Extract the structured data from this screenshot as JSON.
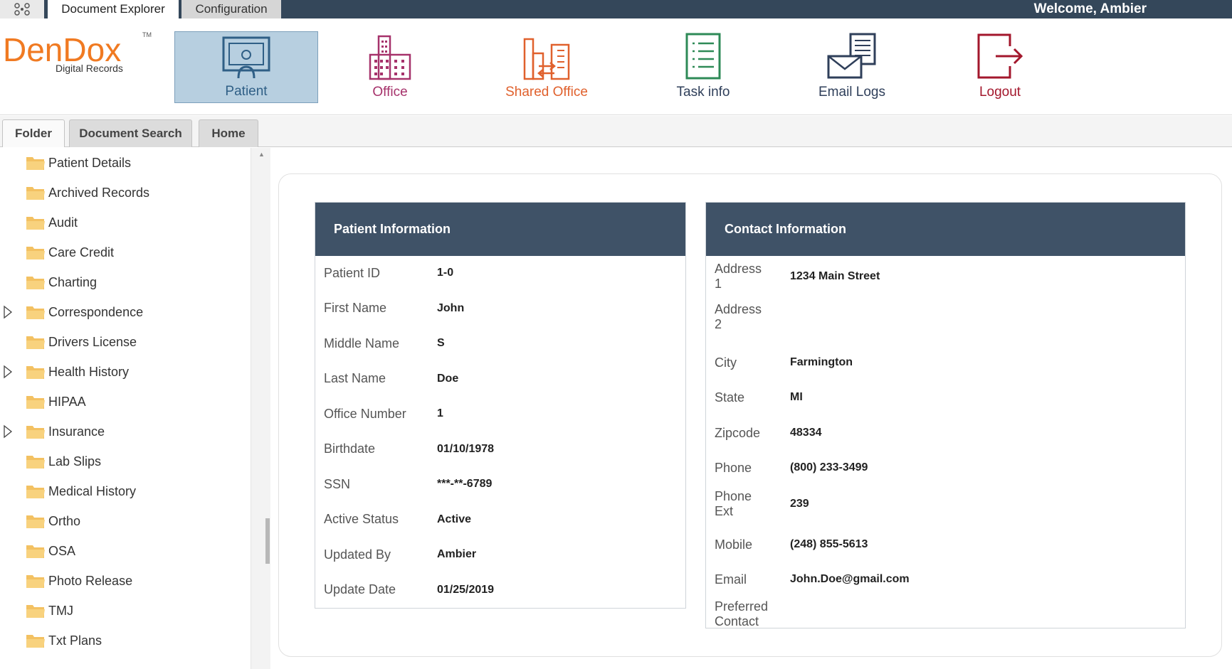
{
  "topbar": {
    "grid_icon": "apps-grid-icon",
    "tabs": [
      "Document Explorer",
      "Configuration"
    ],
    "welcome": "Welcome, Ambier"
  },
  "logo": {
    "main": "DenDox",
    "tm": "TM",
    "sub": "Digital Records"
  },
  "nav": [
    {
      "label": "Patient",
      "icon": "patient-id-card-icon",
      "color": "#2f5f86"
    },
    {
      "label": "Office",
      "icon": "office-building-icon",
      "color": "#a6326b"
    },
    {
      "label": "Shared Office",
      "icon": "shared-office-icon",
      "color": "#e0612d"
    },
    {
      "label": "Task info",
      "icon": "task-list-icon",
      "color": "#2e8a57"
    },
    {
      "label": "Email Logs",
      "icon": "email-log-icon",
      "color": "#2f3f5a"
    },
    {
      "label": "Logout",
      "icon": "logout-icon",
      "color": "#a3172c"
    }
  ],
  "tabs": [
    "Folder",
    "Document Search",
    "Home"
  ],
  "folders": [
    {
      "label": "Patient Details",
      "expandable": false
    },
    {
      "label": "Archived Records",
      "expandable": false
    },
    {
      "label": "Audit",
      "expandable": false
    },
    {
      "label": "Care Credit",
      "expandable": false
    },
    {
      "label": "Charting",
      "expandable": false
    },
    {
      "label": "Correspondence",
      "expandable": true
    },
    {
      "label": "Drivers License",
      "expandable": false
    },
    {
      "label": "Health History",
      "expandable": true
    },
    {
      "label": "HIPAA",
      "expandable": false
    },
    {
      "label": "Insurance",
      "expandable": true
    },
    {
      "label": "Lab Slips",
      "expandable": false
    },
    {
      "label": "Medical History",
      "expandable": false
    },
    {
      "label": "Ortho",
      "expandable": false
    },
    {
      "label": "OSA",
      "expandable": false
    },
    {
      "label": "Photo Release",
      "expandable": false
    },
    {
      "label": "TMJ",
      "expandable": false
    },
    {
      "label": "Txt Plans",
      "expandable": false
    }
  ],
  "patient_info": {
    "title": "Patient Information",
    "rows": [
      {
        "label": "Patient ID",
        "value": "1-0"
      },
      {
        "label": "First Name",
        "value": "John"
      },
      {
        "label": "Middle Name",
        "value": "S"
      },
      {
        "label": "Last Name",
        "value": "Doe"
      },
      {
        "label": "Office Number",
        "value": "1"
      },
      {
        "label": "Birthdate",
        "value": "01/10/1978"
      },
      {
        "label": "SSN",
        "value": "***-**-6789"
      },
      {
        "label": "Active Status",
        "value": "Active"
      },
      {
        "label": "Updated By",
        "value": "Ambier"
      },
      {
        "label": "Update Date",
        "value": "01/25/2019"
      }
    ]
  },
  "contact_info": {
    "title": "Contact Information",
    "rows": [
      {
        "label": "Address 1",
        "value": "1234 Main Street"
      },
      {
        "label": "Address 2",
        "value": ""
      },
      {
        "label": "City",
        "value": "Farmington"
      },
      {
        "label": "State",
        "value": "MI"
      },
      {
        "label": "Zipcode",
        "value": "48334"
      },
      {
        "label": "Phone",
        "value": "(800) 233-3499"
      },
      {
        "label": "Phone Ext",
        "value": "239"
      },
      {
        "label": "Mobile",
        "value": "(248) 855-5613"
      },
      {
        "label": "Email",
        "value": "John.Doe@gmail.com"
      },
      {
        "label": "Preferred Contact",
        "value": ""
      }
    ]
  }
}
